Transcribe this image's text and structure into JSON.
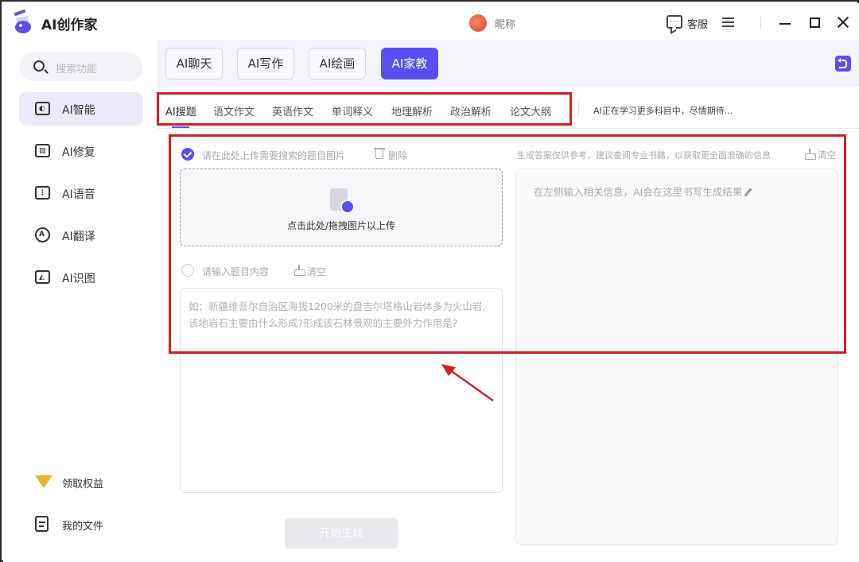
{
  "app": {
    "title": "AI创作家",
    "nickname": "昵称",
    "customer_service": "客服"
  },
  "sidebar": {
    "search_placeholder": "搜索功能",
    "items": [
      {
        "label": "AI智能",
        "icon": "ai-chip-icon",
        "active": true
      },
      {
        "label": "AI修复",
        "icon": "image-repair-icon"
      },
      {
        "label": "AI语音",
        "icon": "voice-icon"
      },
      {
        "label": "AI翻译",
        "icon": "translate-icon"
      },
      {
        "label": "AI识图",
        "icon": "image-recognize-icon"
      }
    ],
    "bottom": [
      {
        "label": "领取权益",
        "icon": "gift-icon"
      },
      {
        "label": "我的文件",
        "icon": "file-icon"
      }
    ]
  },
  "tabs": [
    {
      "label": "AI聊天"
    },
    {
      "label": "AI写作"
    },
    {
      "label": "AI绘画"
    },
    {
      "label": "AI家教",
      "active": true
    }
  ],
  "subtabs": [
    {
      "label": "AI搜题",
      "active": true
    },
    {
      "label": "语文作文"
    },
    {
      "label": "英语作文"
    },
    {
      "label": "单词释义"
    },
    {
      "label": "地理解析"
    },
    {
      "label": "政治解析"
    },
    {
      "label": "论文大纲"
    }
  ],
  "subtab_note": "AI正在学习更多科目中，尽情期待...",
  "upload": {
    "option_label": "请在此处上传需要搜索的题目图片",
    "delete_label": "删除",
    "dropzone_text": "点击此处/拖拽图片以上传"
  },
  "text_input": {
    "option_label": "请输入题目内容",
    "clear_label": "清空",
    "placeholder": "如：新疆维吾尔自治区海拔1200米的盘吉尔塔格山岩体多为火山岩,该地岩石主要由什么形成?形成该石林景观的主要外力作用是?"
  },
  "generate_button": "开始生成",
  "result": {
    "note": "生成答案仅供参考，建议查阅专业书籍，以获取更全面准确的信息",
    "clear_label": "清空",
    "placeholder": "在左侧输入相关信息，AI会在这里书写生成结果"
  },
  "colors": {
    "accent": "#5b4ef0",
    "annotation": "#d11f24"
  }
}
